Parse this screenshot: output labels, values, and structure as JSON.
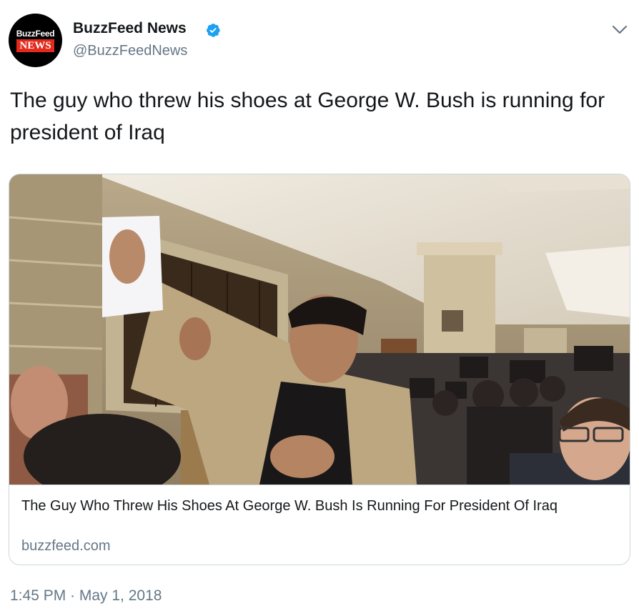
{
  "author": {
    "avatar_brand_top": "BuzzFeed",
    "avatar_brand_bottom": "NEWS",
    "display_name": "BuzzFeed News",
    "handle": "@BuzzFeedNews",
    "verified_icon": "verified-badge-icon"
  },
  "menu_icon": "chevron-down-icon",
  "tweet": {
    "text": "The guy who threw his shoes at George W. Bush is running for president of Iraq"
  },
  "card": {
    "image_icon": "press-conference-photo",
    "title": "The Guy Who Threw His Shoes At George W. Bush Is Running For President Of Iraq",
    "domain": "buzzfeed.com"
  },
  "timestamp": "1:45 PM · May 1, 2018",
  "colors": {
    "text": "#14171a",
    "secondary": "#657786",
    "border": "#ccd6dd",
    "verified": "#1da1f2",
    "brand_red": "#e32a1d"
  }
}
